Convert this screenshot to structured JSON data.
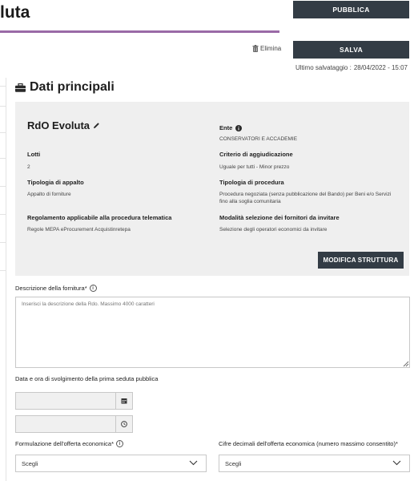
{
  "header": {
    "title_fragment": "luta",
    "publish_label": "PUBBLICA",
    "save_label": "SALVA",
    "delete_label": "Elimina",
    "last_saved_label": "Ultimo salvataggio :",
    "last_saved_value": "28/04/2022 - 15:07"
  },
  "section": {
    "title": "Dati principali"
  },
  "summary": {
    "rdo_title": "RdO Evoluta",
    "ente_label": "Ente",
    "ente_value": "CONSERVATORI E ACCADEMIE",
    "lotti_label": "Lotti",
    "lotti_value": "2",
    "criterio_label": "Criterio di aggiudicazione",
    "criterio_value": "Uguale per tutti - Minor prezzo",
    "tipologia_appalto_label": "Tipologia di appalto",
    "tipologia_appalto_value": "Appalto di forniture",
    "tipologia_procedura_label": "Tipologia di procedura",
    "tipologia_procedura_value_1": "Procedura negoziata (senza pubblicazione del Bando) per Beni e/o Servizi",
    "tipologia_procedura_value_2": "fino alla soglia comunitaria",
    "regolamento_label": "Regolamento applicabile alla procedura telematica",
    "regolamento_value": "Regole MEPA eProcurement Acquistinretepa",
    "modalita_label": "Modalità selezione dei fornitori da invitare",
    "modalita_value": "Selezione degli operatori economici da invitare",
    "modify_label": "MODIFICA STRUTTURA"
  },
  "form": {
    "descrizione_label": "Descrizione della fornitura*",
    "descrizione_placeholder": "Inserisci la descrizione della Rdo. Massimo 4000 caratteri",
    "data_label": "Data e ora di svolgimento della prima seduta pubblica",
    "formulazione_label": "Formulazione dell'offerta economica*",
    "formulazione_value": "Scegli",
    "cifre_label": "Cifre decimali dell'offerta economica (numero massimo consentito)*",
    "cifre_value": "Scegli"
  },
  "icons": {
    "trash": "trash-icon",
    "briefcase": "briefcase-icon",
    "pencil": "pencil-icon",
    "info": "info-icon",
    "calendar": "calendar-icon",
    "clock": "clock-icon",
    "chevron": "chevron-down-icon"
  },
  "colors": {
    "accent_underline": "#9a6aa6",
    "button_dark": "#333c45",
    "panel_bg": "#efefef"
  }
}
